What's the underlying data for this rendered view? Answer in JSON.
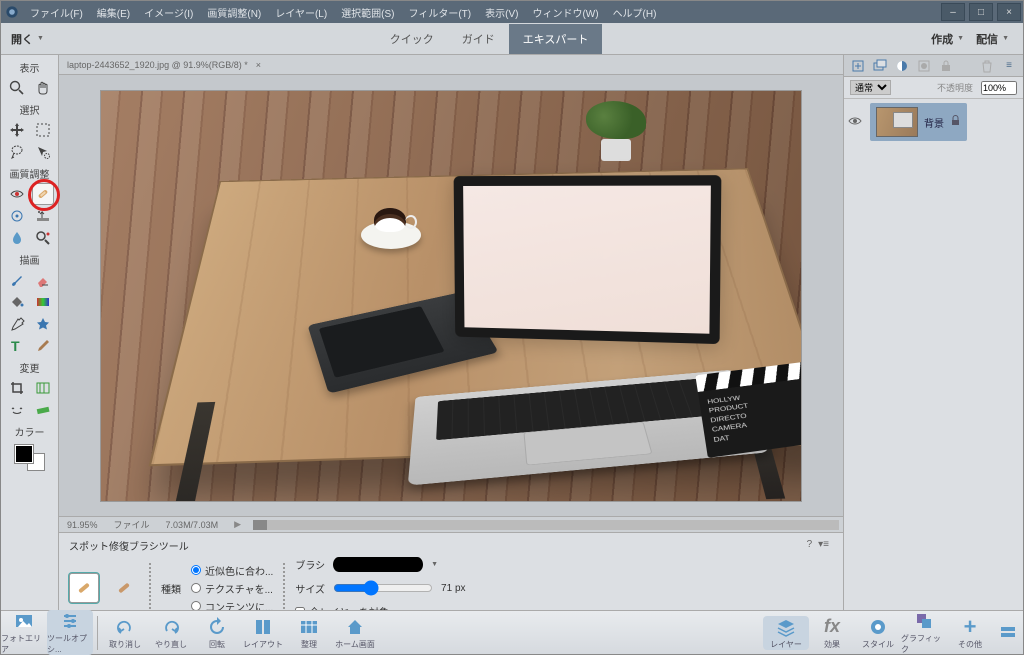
{
  "menubar": {
    "items": [
      "ファイル(F)",
      "編集(E)",
      "イメージ(I)",
      "画質調整(N)",
      "レイヤー(L)",
      "選択範囲(S)",
      "フィルター(T)",
      "表示(V)",
      "ウィンドウ(W)",
      "ヘルプ(H)"
    ]
  },
  "topbar": {
    "open": "開く",
    "tabs": {
      "quick": "クイック",
      "guide": "ガイド",
      "expert": "エキスパート"
    },
    "create": "作成",
    "share": "配信"
  },
  "toolbox": {
    "labels": {
      "view": "表示",
      "select": "選択",
      "enhance": "画質調整",
      "draw": "描画",
      "modify": "変更",
      "color": "カラー"
    }
  },
  "doc": {
    "tab": "laptop-2443652_1920.jpg @ 91.9%(RGB/8) *"
  },
  "clapper": {
    "l1": "HOLLYW",
    "l2": "PRODUCT",
    "l3": "DIRECTO",
    "l4": "CAMERA",
    "l5": "DAT"
  },
  "status": {
    "zoom": "91.95%",
    "filelbl": "ファイル",
    "file": "7.03M/7.03M"
  },
  "options": {
    "title": "スポット修復ブラシツール",
    "type": "種類",
    "r1": "近似色に合わ...",
    "r2": "テクスチャを...",
    "r3": "コンテンツに...",
    "brush": "ブラシ",
    "size": "サイズ",
    "sizeval": "71 px",
    "alllayers": "全レイヤーを対象"
  },
  "layerspanel": {
    "mode": "通常",
    "opacity": "不透明度",
    "opval": "100%",
    "layer": "背景"
  },
  "bottombar": {
    "left": [
      "フォトエリア",
      "ツールオプシ..."
    ],
    "mid": [
      "取り消し",
      "やり直し",
      "回転",
      "レイアウト",
      "整理",
      "ホーム画面"
    ],
    "right": [
      "レイヤー",
      "効果",
      "スタイル",
      "グラフィック",
      "その他"
    ]
  }
}
